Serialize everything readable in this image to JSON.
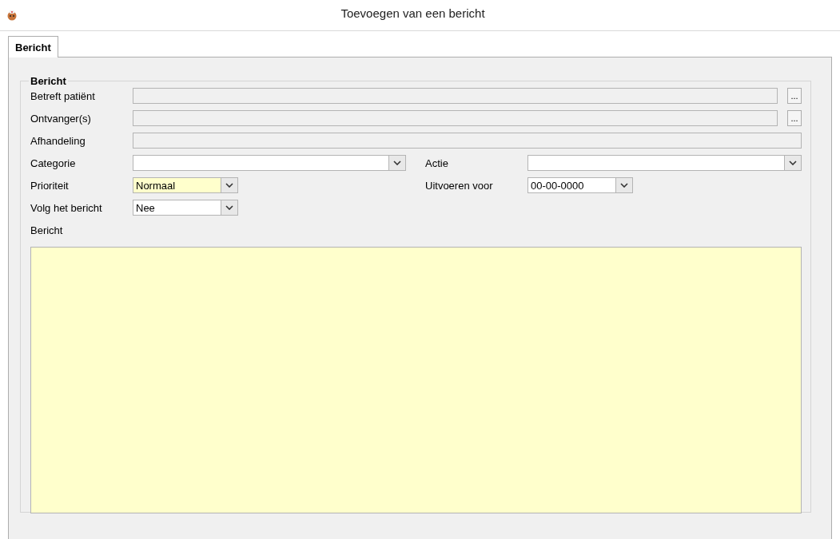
{
  "window": {
    "title": "Toevoegen van een bericht"
  },
  "tabs": [
    {
      "label": "Bericht",
      "selected": true
    }
  ],
  "group": {
    "title": "Bericht"
  },
  "wide_fields": [
    {
      "label": "Betreft patiënt",
      "kind": "lookup",
      "disabled": true
    },
    {
      "label": "Ontvanger(s)",
      "kind": "lookup",
      "disabled": true
    },
    {
      "label": "Afhandeling",
      "kind": "text",
      "disabled": true
    }
  ],
  "browse_button": "...",
  "left_fields": [
    {
      "label": "Categorie",
      "highlighted": false,
      "kind": "wide"
    },
    {
      "label": "Prioriteit",
      "value": "Normaal",
      "highlighted": true,
      "kind": "narrow"
    },
    {
      "label": "Volg het bericht",
      "value": "Nee",
      "highlighted": false,
      "kind": "narrow"
    }
  ],
  "right_fields": [
    {
      "label": "Actie",
      "highlighted": false,
      "kind": "wide"
    },
    {
      "label": "Uitvoeren voor",
      "value": "00-00-0000",
      "highlighted": false,
      "kind": "narrow"
    }
  ],
  "message": {
    "label": "Bericht"
  }
}
